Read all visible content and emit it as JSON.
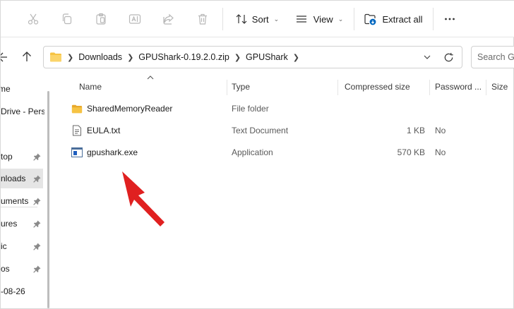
{
  "toolbar": {
    "sort_label": "Sort",
    "view_label": "View",
    "extract_label": "Extract all",
    "icons": [
      "cut-icon",
      "copy-icon",
      "paste-icon",
      "rename-icon",
      "share-icon",
      "delete-icon",
      "sort-icon",
      "view-icon",
      "extract-icon",
      "more-icon"
    ]
  },
  "address": {
    "crumbs": [
      "Downloads",
      "GPUShark-0.19.2.0.zip",
      "GPUShark"
    ],
    "search_placeholder": "Search GP"
  },
  "navpane": {
    "items": [
      {
        "label": "me",
        "pinned": false,
        "selected": false
      },
      {
        "label": "Drive - Perso",
        "pinned": false,
        "selected": false
      },
      {
        "label": "top",
        "pinned": true,
        "selected": false
      },
      {
        "label": "nloads",
        "pinned": true,
        "selected": true
      },
      {
        "label": "uments",
        "pinned": true,
        "selected": false
      },
      {
        "label": "ures",
        "pinned": true,
        "selected": false
      },
      {
        "label": "ic",
        "pinned": true,
        "selected": false
      },
      {
        "label": "os",
        "pinned": true,
        "selected": false
      },
      {
        "label": "-08-26",
        "pinned": false,
        "selected": false
      }
    ]
  },
  "columns": {
    "name": "Name",
    "type": "Type",
    "compressed": "Compressed size",
    "password": "Password ...",
    "size": "Size"
  },
  "files": [
    {
      "name": "SharedMemoryReader",
      "type": "File folder",
      "compressed": "",
      "password": "",
      "icon": "folder-icon"
    },
    {
      "name": "EULA.txt",
      "type": "Text Document",
      "compressed": "1 KB",
      "password": "No",
      "icon": "text-file-icon"
    },
    {
      "name": "gpushark.exe",
      "type": "Application",
      "compressed": "570 KB",
      "password": "No",
      "icon": "application-icon"
    }
  ],
  "colors": {
    "accent": "#0067c0",
    "folder": "#f6c343",
    "annotation_arrow": "#e02020",
    "selection": "#e5e5e5"
  }
}
